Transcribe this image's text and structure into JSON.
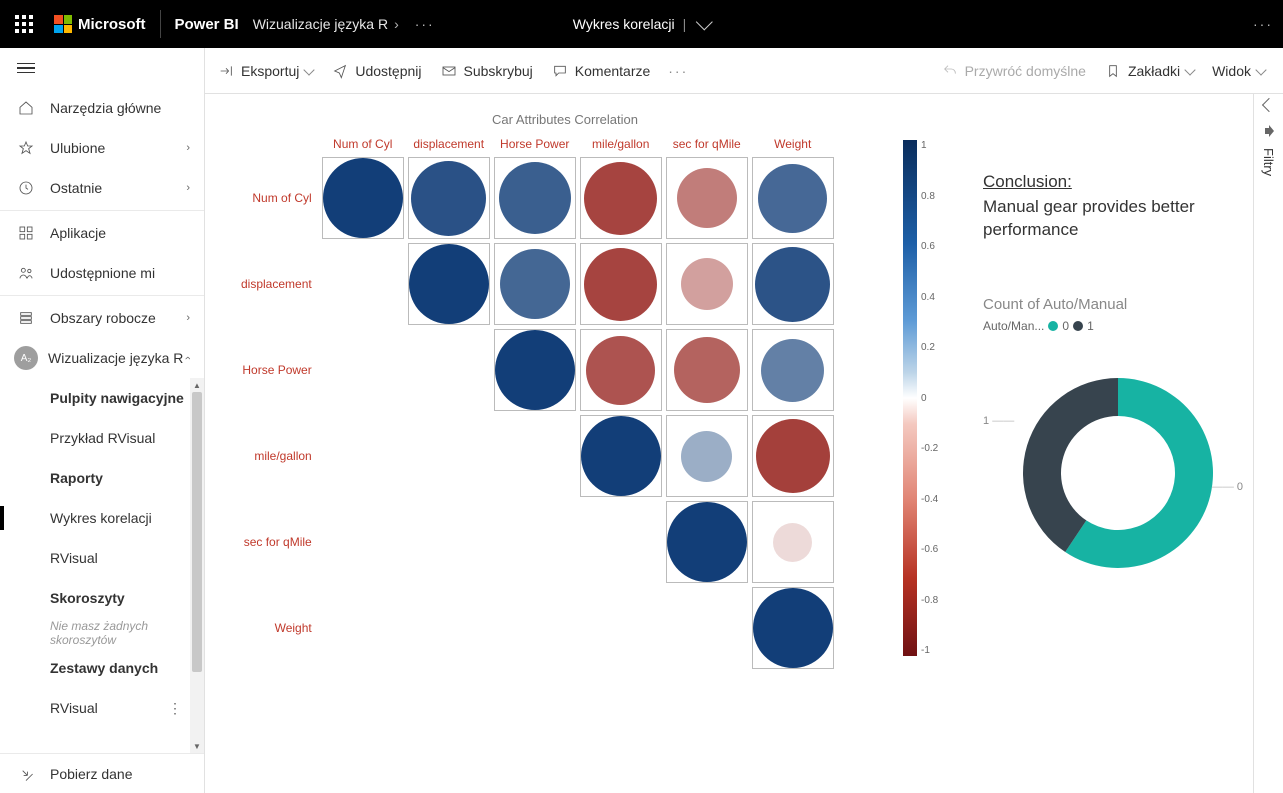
{
  "topbar": {
    "ms": "Microsoft",
    "app": "Power BI",
    "breadcrumb": "Wizualizacje języka R",
    "more": "···",
    "title": "Wykres korelacji",
    "title_pipe": "|",
    "right_more": "···"
  },
  "nav": {
    "home": "Narzędzia główne",
    "fav": "Ulubione",
    "recent": "Ostatnie",
    "apps": "Aplikacje",
    "shared": "Udostępnione mi",
    "workspaces": "Obszary robocze",
    "ws_current": "Wizualizacje języka R",
    "ws_badge": "A₂",
    "tree": {
      "dash_head": "Pulpity nawigacyjne",
      "dash1": "Przykład RVisual",
      "rep_head": "Raporty",
      "rep1": "Wykres korelacji",
      "rep2": "RVisual",
      "wb_head": "Skoroszyty",
      "wb_empty": "Nie masz żadnych skoroszytów",
      "ds_head": "Zestawy danych",
      "ds1": "RVisual"
    },
    "footer": "Pobierz dane"
  },
  "actions": {
    "export": "Eksportuj",
    "share": "Udostępnij",
    "subscribe": "Subskrybuj",
    "comments": "Komentarze",
    "more": "···",
    "reset": "Przywróć domyślne",
    "bookmarks": "Zakładki",
    "view": "Widok"
  },
  "report": {
    "corr_title": "Car Attributes Correlation",
    "vars": [
      "Num of Cyl",
      "displacement",
      "Horse Power",
      "mile/gallon",
      "sec for qMile",
      "Weight"
    ],
    "colorbar": [
      "1",
      "0.8",
      "0.6",
      "0.4",
      "0.2",
      "0",
      "-0.2",
      "-0.4",
      "-0.6",
      "-0.8",
      "-1"
    ],
    "conclusion_head": "Conclusion:",
    "conclusion_text": "Manual gear provides better performance",
    "count_title": "Count of Auto/Manual",
    "legend_label": "Auto/Man...",
    "legend0": "0",
    "legend1": "1",
    "donut_lbl0": "0",
    "donut_lbl1": "1"
  },
  "filters": {
    "label": "Filtry"
  },
  "chart_data": [
    {
      "type": "heatmap",
      "title": "Car Attributes Correlation",
      "variables": [
        "Num of Cyl",
        "displacement",
        "Horse Power",
        "mile/gallon",
        "sec for qMile",
        "Weight"
      ],
      "matrix": [
        [
          1.0,
          0.9,
          0.83,
          -0.85,
          -0.59,
          0.78
        ],
        [
          null,
          1.0,
          0.79,
          -0.85,
          -0.43,
          0.89
        ],
        [
          null,
          null,
          1.0,
          -0.78,
          -0.71,
          0.66
        ],
        [
          null,
          null,
          null,
          1.0,
          0.42,
          -0.87
        ],
        [
          null,
          null,
          null,
          null,
          1.0,
          -0.17
        ],
        [
          null,
          null,
          null,
          null,
          null,
          1.0
        ]
      ],
      "color_scale": {
        "min": -1,
        "max": 1,
        "low": "#701113",
        "mid": "#ffffff",
        "high": "#0a2d5c"
      }
    },
    {
      "type": "pie",
      "title": "Count of Auto/Manual",
      "series": [
        {
          "name": "0",
          "value": 19,
          "color": "#17b3a3"
        },
        {
          "name": "1",
          "value": 13,
          "color": "#37444e"
        }
      ],
      "layout": {
        "hole": 0.6
      }
    }
  ]
}
